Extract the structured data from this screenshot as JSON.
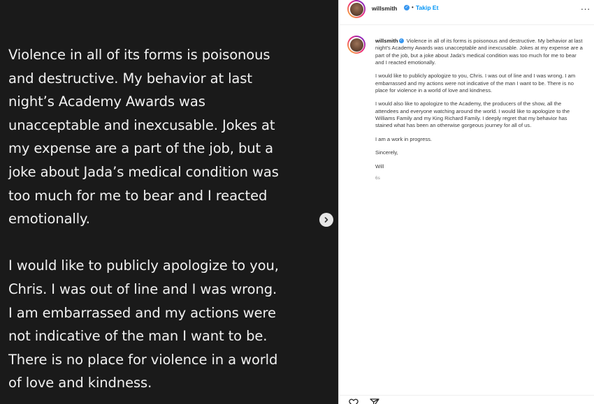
{
  "media": {
    "paragraphs": [
      "Violence in all of its forms is poisonous\nand destructive. My behavior at last\nnight’s Academy Awards was\nunacceptable and inexcusable. Jokes at\nmy expense are a part of the job, but a\njoke about Jada’s medical condition was\ntoo much for me to bear and I reacted\nemotionally.",
      "I would like to publicly apologize to you,\nChris. I was out of line and I was wrong.\nI am embarrassed and my actions were\nnot indicative of the man I want to be.\nThere is no place for violence in a world\nof love and kindness."
    ],
    "next_icon": "chevron-right-icon"
  },
  "post": {
    "username": "willsmith",
    "separator": "•",
    "follow_label": "Takip Et",
    "more_label": "...",
    "caption": {
      "username": "willsmith",
      "first_paragraph": "Violence in all of its forms is poisonous and destructive. My behavior at last night’s Academy Awards was unacceptable and inexcusable. Jokes at my expense are a part of the job, but a joke about Jada’s medical condition was too much for me to bear and I reacted emotionally.",
      "paragraphs": [
        "I would like to publicly apologize to you, Chris. I was out of line and I was wrong. I am embarrassed and my actions were not indicative of the man I want to be. There is no place for violence in a world of love and kindness.",
        "I would also like to apologize to the Academy, the producers of the show, all the attendees and everyone watching around the world. I would like to apologize to the Williams Family and my King Richard Family. I deeply regret that my behavior has stained what has been an otherwise gorgeous journey for all of us.",
        "I am a work in progress.",
        "Sincerely,",
        "Will"
      ],
      "time_ago": "6s"
    }
  },
  "colors": {
    "media_bg": "#1a1a1a",
    "media_text": "#f2f2f2",
    "link_blue": "#0095f6",
    "verified_blue": "#3897f0"
  },
  "icons": [
    "chevron-right-icon",
    "verified-badge-icon",
    "more-options-icon",
    "heart-icon",
    "share-icon"
  ]
}
